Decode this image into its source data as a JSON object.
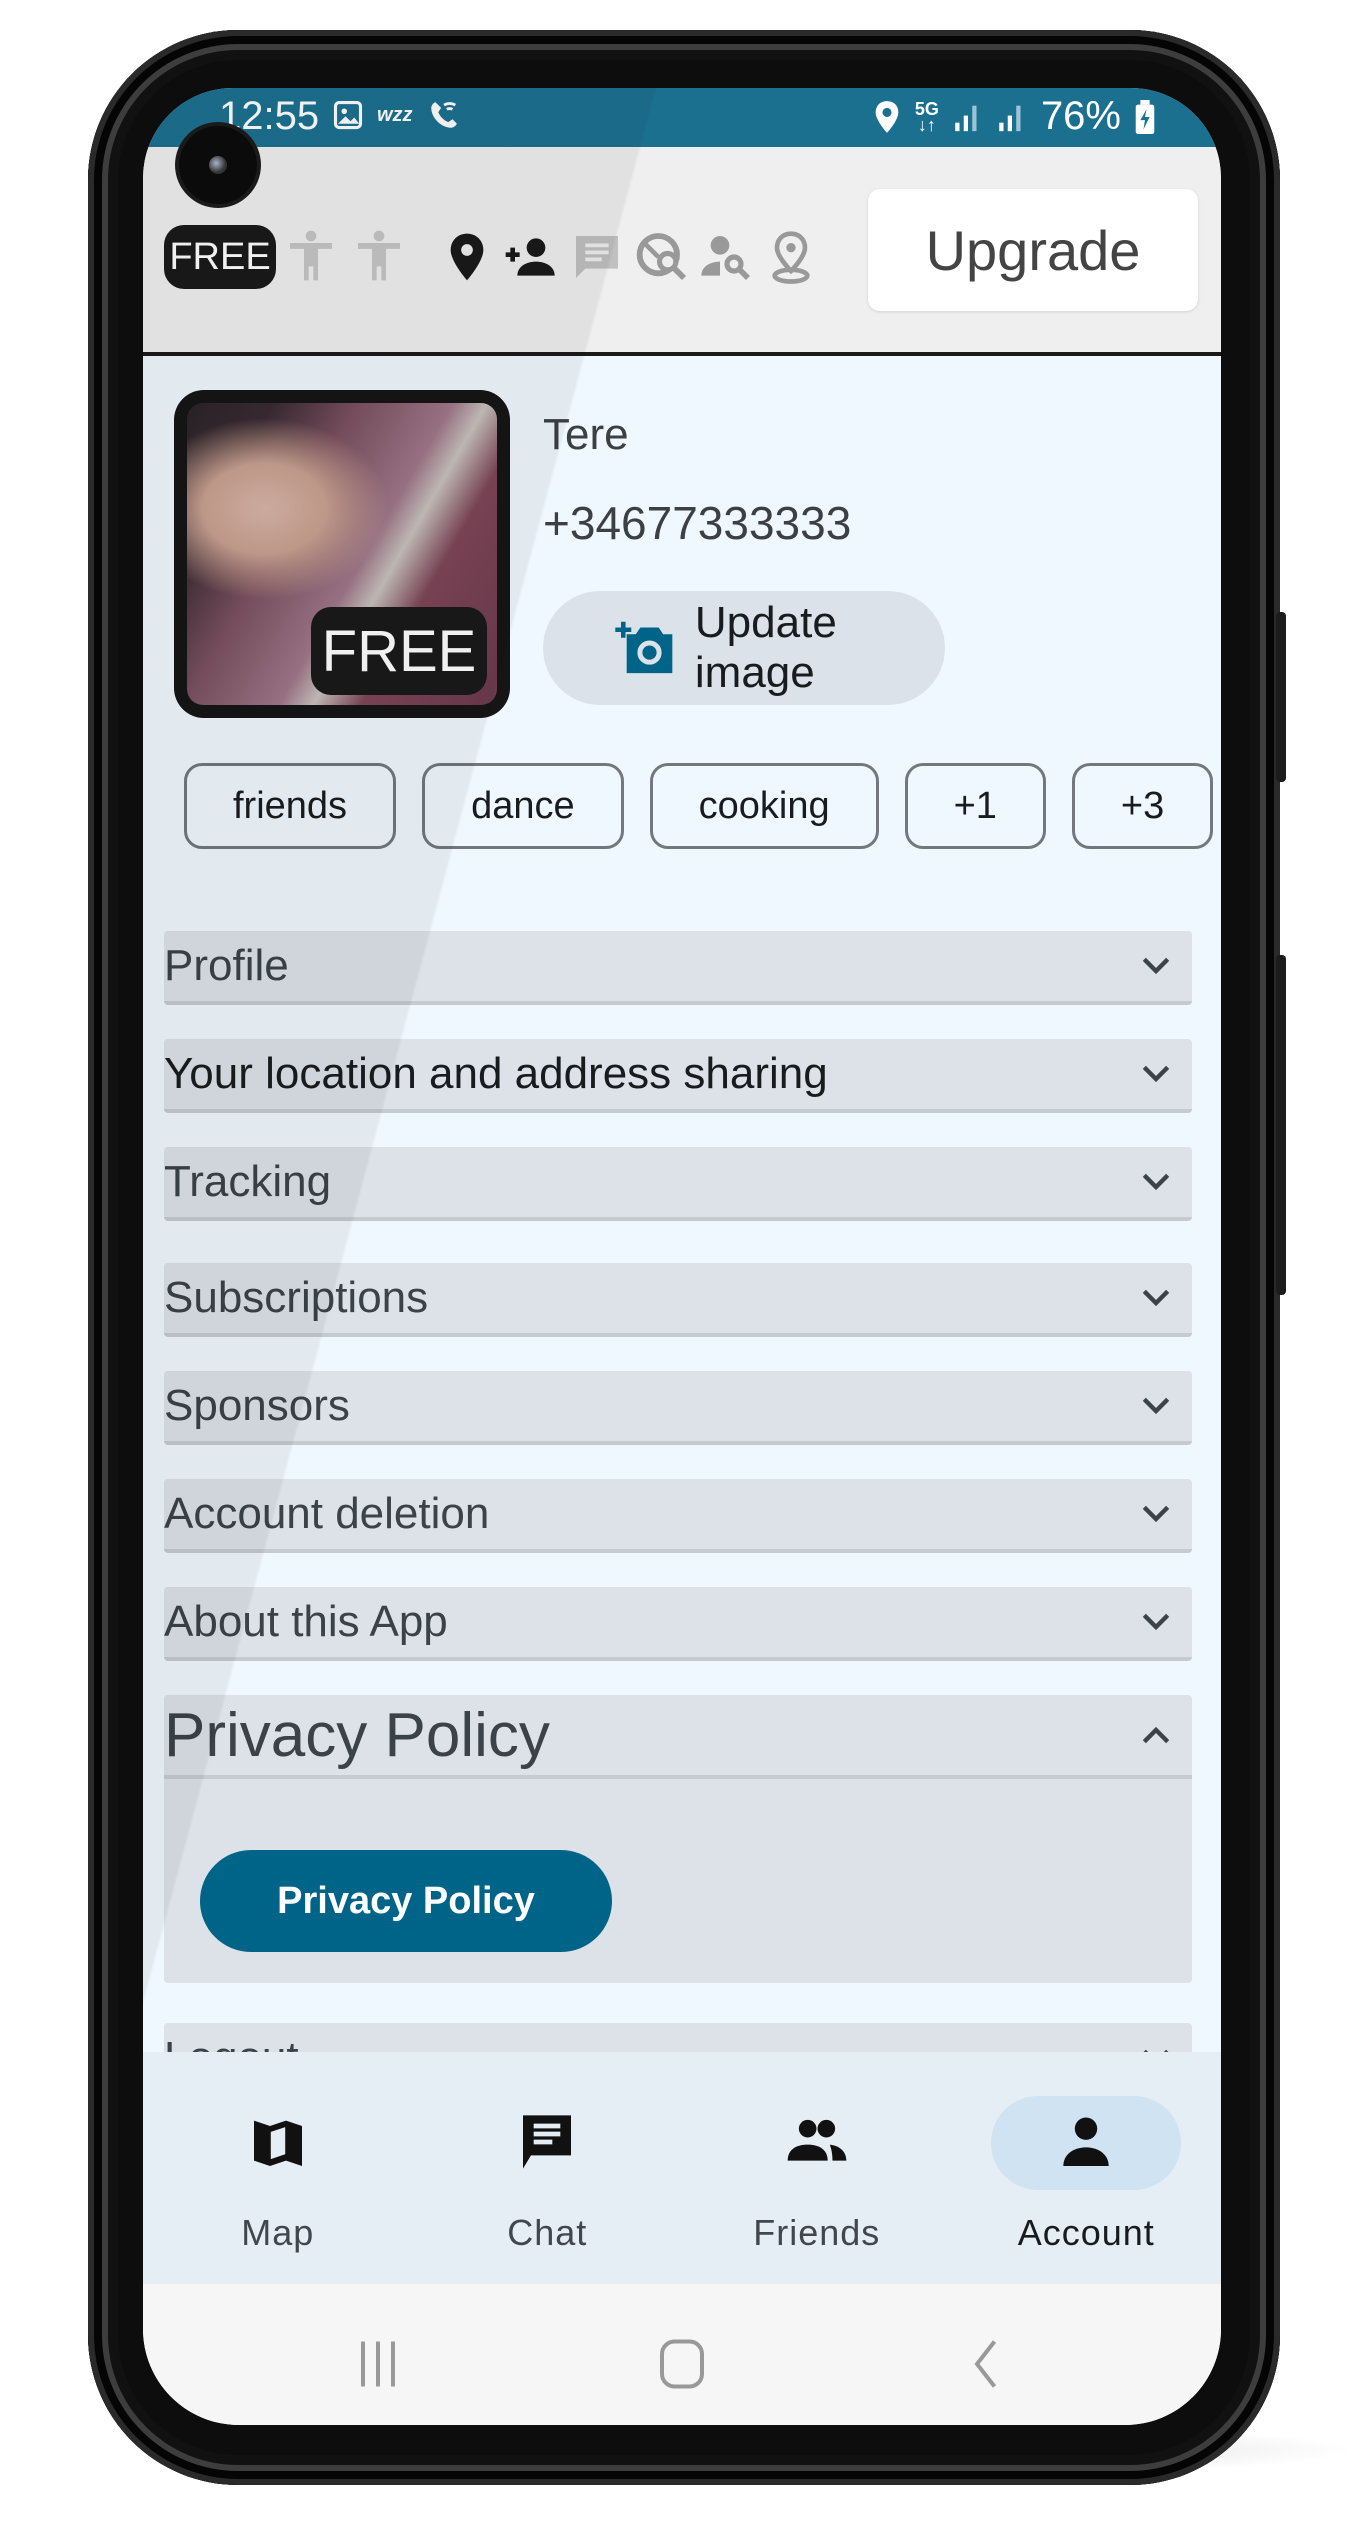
{
  "status_bar": {
    "time": "12:55",
    "left_icons": [
      "gallery-icon",
      "wizz-icon",
      "wifi-calling-icon"
    ],
    "wizz_label": "wzz",
    "right_icons": [
      "location-icon",
      "5g-data-icon",
      "signal-1-icon",
      "signal-2-icon"
    ],
    "network_label": "5G",
    "battery": "76%"
  },
  "header": {
    "plan_badge": "FREE",
    "feature_icons": [
      "accessibility-icon",
      "accessibility-icon",
      "location-pin-icon",
      "add-person-icon",
      "chat-icon",
      "travel-explore-icon",
      "person-search-icon",
      "pin-drop-icon"
    ],
    "upgrade_label": "Upgrade"
  },
  "profile": {
    "avatar_badge": "FREE",
    "name": "Tere",
    "phone": "+34677333333",
    "update_image_label": "Update image"
  },
  "interests": [
    "friends",
    "dance",
    "cooking",
    "+1",
    "+3"
  ],
  "sections": [
    {
      "title": "Profile",
      "expanded": false
    },
    {
      "title": "Your location and address sharing",
      "expanded": false
    },
    {
      "title": "Tracking",
      "expanded": false
    },
    {
      "title": "Subscriptions",
      "expanded": false
    },
    {
      "title": "Sponsors",
      "expanded": false
    },
    {
      "title": "Account deletion",
      "expanded": false
    },
    {
      "title": "About this App",
      "expanded": false
    },
    {
      "title": "Privacy Policy",
      "expanded": true,
      "button_label": "Privacy Policy"
    },
    {
      "title": "Logout",
      "expanded": false
    }
  ],
  "bottom_nav": {
    "items": [
      {
        "label": "Map",
        "icon": "map-icon",
        "active": false
      },
      {
        "label": "Chat",
        "icon": "chat-icon",
        "active": false
      },
      {
        "label": "Friends",
        "icon": "friends-icon",
        "active": false
      },
      {
        "label": "Account",
        "icon": "account-icon",
        "active": true
      }
    ]
  },
  "colors": {
    "primary": "#006489",
    "status_bar": "#1b7090",
    "accordion_bg": "#dce2e8",
    "screen_bg": "#f0f8ff",
    "nav_bg": "#e5edf5",
    "nav_active_pill": "#cfe3f3"
  }
}
